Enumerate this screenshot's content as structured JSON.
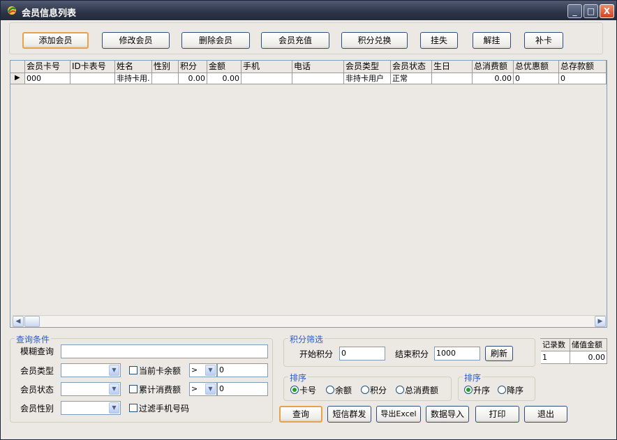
{
  "window": {
    "title": "会员信息列表",
    "min_label": "_",
    "max_label": "□",
    "close_label": "X"
  },
  "toolbar": [
    {
      "label": "添加会员"
    },
    {
      "label": "修改会员"
    },
    {
      "label": "删除会员"
    },
    {
      "label": "会员充值"
    },
    {
      "label": "积分兑换"
    },
    {
      "label": "挂失"
    },
    {
      "label": "解挂"
    },
    {
      "label": "补卡"
    }
  ],
  "grid": {
    "columns": [
      "会员卡号",
      "ID卡表号",
      "姓名",
      "性别",
      "积分",
      "金额",
      "手机",
      "电话",
      "会员类型",
      "会员状态",
      "生日",
      "总消费额",
      "总优惠额",
      "总存款额"
    ],
    "rows": [
      [
        "000",
        "",
        "非持卡用.",
        "",
        "0.00",
        "0.00",
        "",
        "",
        "非持卡用户",
        "正常",
        "",
        "0.00",
        "0",
        "0"
      ]
    ],
    "row_marker": "▶"
  },
  "query": {
    "group_label": "查询条件",
    "fuzzy_label": "模糊查询",
    "fuzzy_value": "",
    "type_label": "会员类型",
    "type_value": "",
    "status_label": "会员状态",
    "status_value": "",
    "gender_label": "会员性别",
    "gender_value": "",
    "balance_check_label": "当前卡余额",
    "balance_op": ">",
    "balance_value": "0",
    "consume_check_label": "累计消费额",
    "consume_op": ">",
    "consume_value": "0",
    "filter_phone_label": "过滤手机号码"
  },
  "points": {
    "group_label": "积分筛选",
    "start_label": "开始积分",
    "start_value": "0",
    "end_label": "结束积分",
    "end_value": "1000",
    "refresh_label": "刷新"
  },
  "sort_field": {
    "group_label": "排序",
    "options": [
      "卡号",
      "余额",
      "积分",
      "总消费额"
    ],
    "selected": "卡号"
  },
  "sort_order": {
    "group_label": "排序",
    "options": [
      "升序",
      "降序"
    ],
    "selected": "升序"
  },
  "summary": {
    "headers": [
      "记录数",
      "储值金额"
    ],
    "values": [
      "1",
      "0.00"
    ]
  },
  "bottom_buttons": [
    {
      "label": "查询"
    },
    {
      "label": "短信群发"
    },
    {
      "label": "导出Excel"
    },
    {
      "label": "数据导入"
    },
    {
      "label": "打印"
    },
    {
      "label": "退出"
    }
  ],
  "icons": {
    "app": "app-logo-icon",
    "dropdown": "chevron-down-icon",
    "scroll_left": "arrow-left-icon",
    "scroll_right": "arrow-right-icon"
  },
  "colors": {
    "titlebar": "#2c3448",
    "group_label": "#2a5ac9",
    "default_button_border": "#e6a34a",
    "close_button": "#d2421e"
  }
}
